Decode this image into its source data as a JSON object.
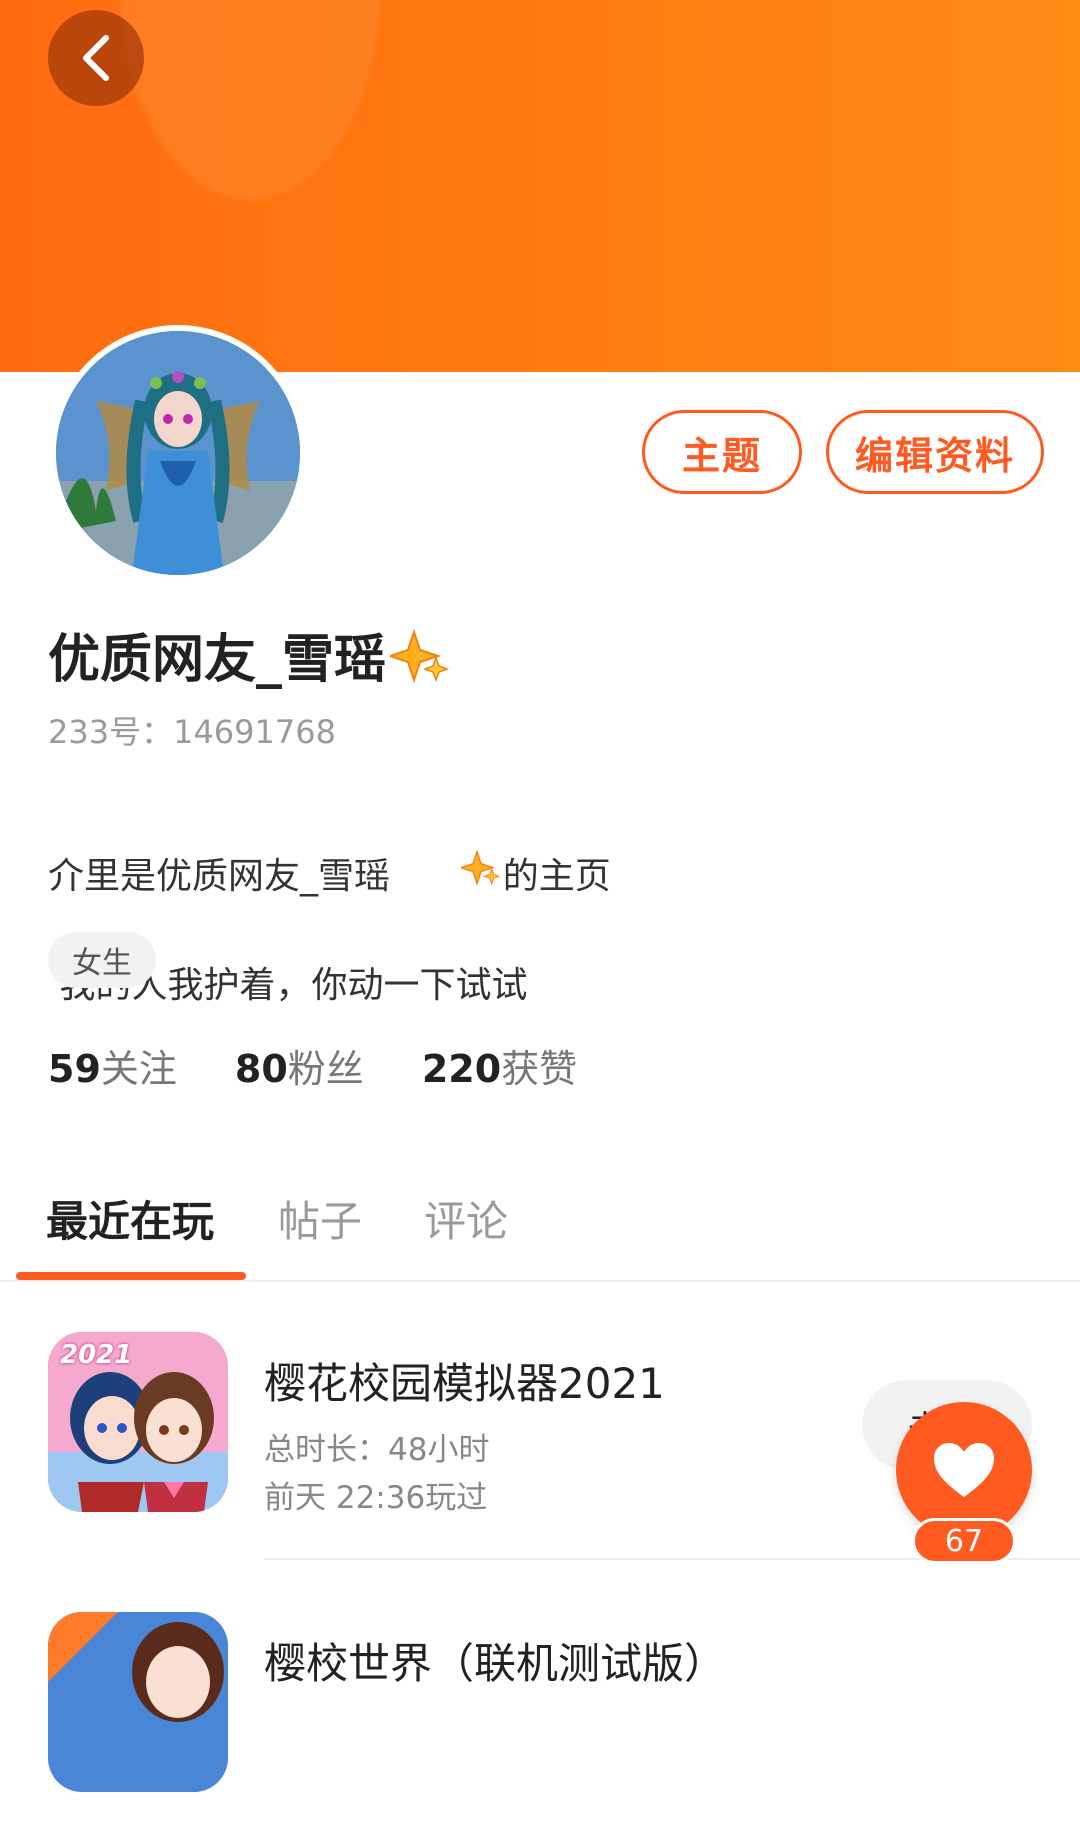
{
  "header": {
    "back_icon": "chevron-left-icon",
    "banner_color": "#ff7a10"
  },
  "profile": {
    "name": "优质网友_雪瑶",
    "uid": "233号：14691768",
    "bio_line1_prefix": "介里是优质网友_雪瑶",
    "bio_line1_suffix": "的主页",
    "bio_line2": " 我的人我护着，你动一下试试",
    "gender_tag": "女生"
  },
  "actions": {
    "theme_label": "主题",
    "edit_label": "编辑资料",
    "accent": "#ff5a1f"
  },
  "stats": {
    "following_count": "59",
    "following_label": "关注",
    "followers_count": "80",
    "followers_label": "粉丝",
    "likes_count": "220",
    "likes_label": "获赞"
  },
  "tabs": [
    {
      "label": "最近在玩",
      "active": true
    },
    {
      "label": "帖子",
      "active": false
    },
    {
      "label": "评论",
      "active": false
    }
  ],
  "games": [
    {
      "badge": "2021",
      "title": "樱花校园模拟器2021",
      "duration": "总时长：48小时",
      "last_played": "前天 22:36玩过",
      "open_label": "去"
    },
    {
      "title": "樱校世界（联机测试版）"
    }
  ],
  "like_fab": {
    "icon": "heart-icon",
    "count": "67"
  }
}
